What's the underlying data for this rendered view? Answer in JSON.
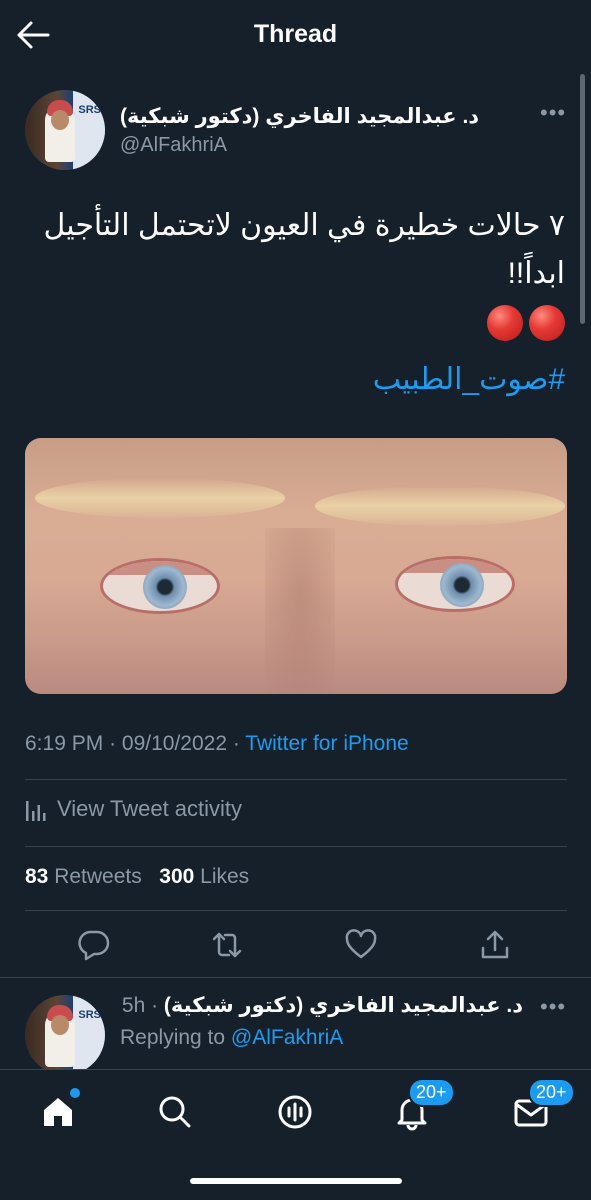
{
  "header": {
    "title": "Thread"
  },
  "tweet": {
    "author_name": "د. عبدالمجيد الفاخري (دكتور شبكية)",
    "author_handle": "@AlFakhriA",
    "text": "٧ حالات خطيرة في العيون لاتحتمل التأجيل ابداً!!",
    "hashtag": "#صوت_الطبيب",
    "time": "6:19 PM",
    "date": "09/10/2022",
    "source": "Twitter for iPhone",
    "view_activity_label": "View Tweet activity",
    "retweets_count": "83",
    "retweets_label": "Retweets",
    "likes_count": "300",
    "likes_label": "Likes"
  },
  "reply": {
    "author_name": "د. عبدالمجيد الفاخري (دكتور شبكية)",
    "time_ago": "5h",
    "replying_prefix": "Replying to",
    "replying_handle": "@AlFakhriA"
  },
  "avatar_poster_text": "SRS",
  "tabbar": {
    "notifications_badge": "20+",
    "messages_badge": "20+"
  },
  "colors": {
    "background": "#15202b",
    "accent": "#1d9bf0",
    "secondary_text": "#8b98a5",
    "divider": "#38444d"
  }
}
